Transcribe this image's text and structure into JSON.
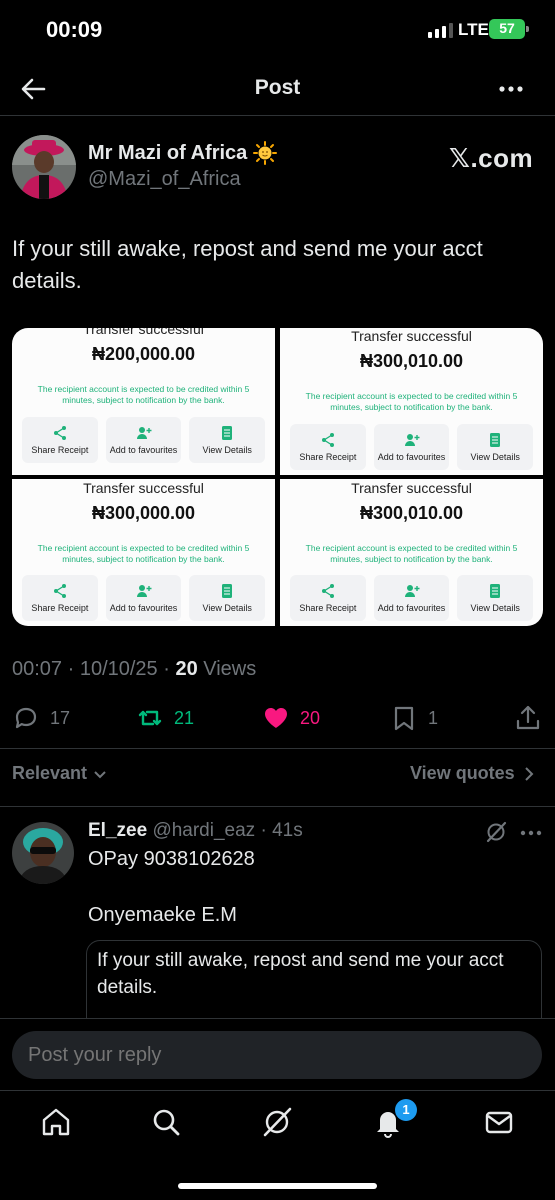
{
  "status_bar": {
    "time": "00:09",
    "network": "LTE",
    "battery": "57"
  },
  "nav": {
    "title": "Post"
  },
  "author": {
    "name": "Mr Mazi of Africa",
    "handle": "@Mazi_of_Africa",
    "source": "𝕏.com"
  },
  "post": {
    "text": "If your still awake,  repost and send me your acct details.",
    "receipts": [
      {
        "title": "Transfer successful",
        "amount": "₦200,000.00",
        "note": "The recipient account is expected to be credited within 5 minutes, subject to notification by the bank.",
        "share": "Share Receipt",
        "favourite": "Add to favourites",
        "details": "View Details"
      },
      {
        "title": "Transfer successful",
        "amount": "₦300,010.00",
        "note": "The recipient account is expected to be credited within 5 minutes, subject to notification by the bank.",
        "share": "Share Receipt",
        "favourite": "Add to favourites",
        "details": "View Details"
      },
      {
        "title": "Transfer successful",
        "amount": "₦300,000.00",
        "note": "The recipient account is expected to be credited within 5 minutes, subject to notification by the bank.",
        "share": "Share Receipt",
        "favourite": "Add to favourites",
        "details": "View Details"
      },
      {
        "title": "Transfer successful",
        "amount": "₦300,010.00",
        "note": "The recipient account is expected to be credited within 5 minutes, subject to notification by the bank.",
        "share": "Share Receipt",
        "favourite": "Add to favourites",
        "details": "View Details"
      }
    ],
    "timestamp": "00:07 · 10/10/25 · ",
    "views_count": "20",
    "views_label": " Views"
  },
  "stats": {
    "replies": "17",
    "reposts": "21",
    "likes": "20",
    "bookmarks": "1"
  },
  "colors": {
    "repost": "#00ba7c",
    "like": "#f91880",
    "muted": "#71767b",
    "accent": "#1d9bf0"
  },
  "sort": {
    "relevant": "Relevant",
    "view_quotes": "View quotes"
  },
  "reply": {
    "name": "El_zee",
    "handle": "@hardi_eaz",
    "time": " · 41s",
    "line1": "OPay 9038102628",
    "line2": "Onyemaeke E.M",
    "quote_text": "If your still awake,  repost and send me your acct details."
  },
  "composer": {
    "placeholder": "Post your reply"
  },
  "tabbar": {
    "notifications_badge": "1"
  }
}
